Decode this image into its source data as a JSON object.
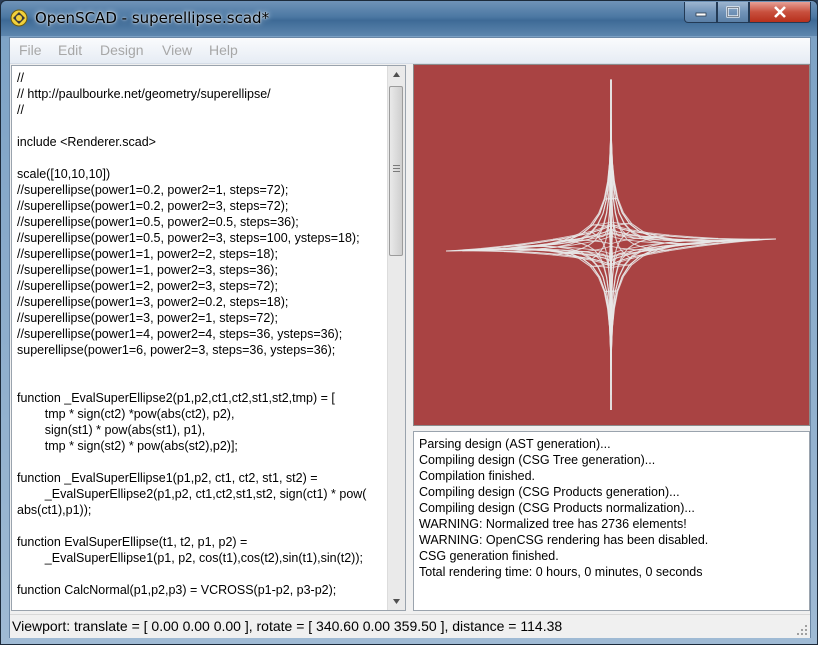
{
  "window": {
    "title": "OpenSCAD - superellipse.scad*",
    "icon": "openscad-logo-icon",
    "controls": {
      "minimize": "minimize-icon",
      "maximize": "maximize-icon",
      "close": "close-icon"
    }
  },
  "menu": [
    "File",
    "Edit",
    "Design",
    "View",
    "Help"
  ],
  "editor": {
    "lines": [
      "//",
      "// http://paulbourke.net/geometry/superellipse/",
      "//",
      "",
      "include <Renderer.scad>",
      "",
      "scale([10,10,10])",
      "//superellipse(power1=0.2, power2=1, steps=72);",
      "//superellipse(power1=0.2, power2=3, steps=72);",
      "//superellipse(power1=0.5, power2=0.5, steps=36);",
      "//superellipse(power1=0.5, power2=3, steps=100, ysteps=18);",
      "//superellipse(power1=1, power2=2, steps=18);",
      "//superellipse(power1=1, power2=3, steps=36);",
      "//superellipse(power1=2, power2=3, steps=72);",
      "//superellipse(power1=3, power2=0.2, steps=18);",
      "//superellipse(power1=3, power2=1, steps=72);",
      "//superellipse(power1=4, power2=4, steps=36, ysteps=36);",
      "superellipse(power1=6, power2=3, steps=36, ysteps=36);",
      "",
      "",
      "function _EvalSuperEllipse2(p1,p2,ct1,ct2,st1,st2,tmp) = [",
      "        tmp * sign(ct2) *pow(abs(ct2), p2),",
      "        sign(st1) * pow(abs(st1), p1),",
      "        tmp * sign(st2) * pow(abs(st2),p2)];",
      "",
      "function _EvalSuperEllipse1(p1,p2, ct1, ct2, st1, st2) =",
      "        _EvalSuperEllipse2(p1,p2, ct1,ct2,st1,st2, sign(ct1) * pow(",
      "abs(ct1),p1));",
      "",
      "function EvalSuperEllipse(t1, t2, p1, p2) =",
      "        _EvalSuperEllipse1(p1, p2, cos(t1),cos(t2),sin(t1),sin(t2));",
      "",
      "function CalcNormal(p1,p2,p3) = VCROSS(p1-p2, p3-p2);"
    ]
  },
  "viewport": {
    "background": "#a94343",
    "mesh_color": "#e8e8e8"
  },
  "console": {
    "lines": [
      "Parsing design (AST generation)...",
      "Compiling design (CSG Tree generation)...",
      "Compilation finished.",
      "Compiling design (CSG Products generation)...",
      "Compiling design (CSG Products normalization)...",
      "WARNING: Normalized tree has 2736 elements!",
      "WARNING: OpenCSG rendering has been disabled.",
      "CSG generation finished.",
      "Total rendering time: 0 hours, 0 minutes, 0 seconds"
    ]
  },
  "status": "Viewport: translate = [ 0.00 0.00 0.00 ], rotate = [ 340.60 0.00 359.50 ], distance = 114.38"
}
